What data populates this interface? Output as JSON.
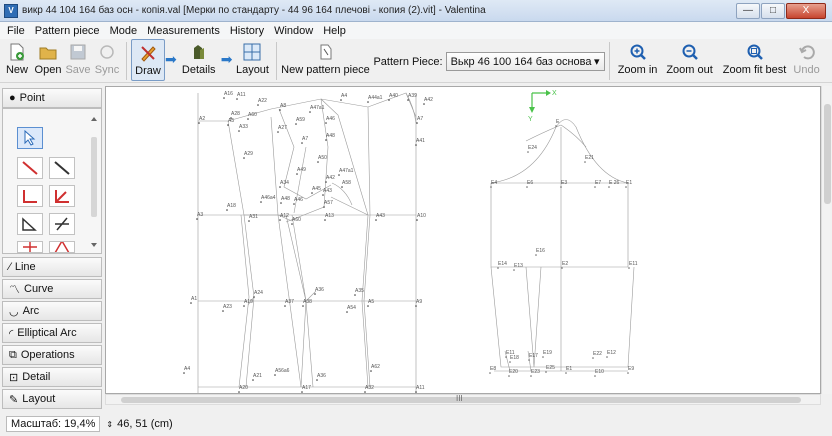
{
  "window": {
    "title": "викр 44 104 164 баз осн - копія.val [Мерки по стандарту - 44 96 164 плечові - копия (2).vit] - Valentina",
    "app_icon": "V",
    "minimize": "—",
    "maximize": "□",
    "close": "X"
  },
  "menu": [
    "File",
    "Pattern piece",
    "Mode",
    "Measurements",
    "History",
    "Window",
    "Help"
  ],
  "toolbar": {
    "new": "New",
    "open": "Open",
    "save": "Save",
    "sync": "Sync",
    "draw": "Draw",
    "details": "Details",
    "layout": "Layout",
    "new_pattern_piece": "New pattern piece",
    "pattern_piece_label": "Pattern Piece:",
    "pattern_piece_value": "Вькр 46 100 164 баз основа",
    "zoom_in": "Zoom in",
    "zoom_out": "Zoom out",
    "zoom_fit": "Zoom fit best",
    "undo": "Undo"
  },
  "left": {
    "point": "Point",
    "line": "Line",
    "curve": "Curve",
    "arc": "Arc",
    "elliptical_arc": "Elliptical Arc",
    "operations": "Operations",
    "detail": "Detail",
    "layout": "Layout"
  },
  "status": {
    "scale_label": "Масштаб: 19,4%",
    "coords": "46, 51 (cm)"
  },
  "canvas": {
    "axis_x": "X",
    "axis_y": "Y",
    "hscroll_marker": "III",
    "left_labels": [
      [
        "A16",
        118,
        8
      ],
      [
        "A11",
        131,
        9
      ],
      [
        "A22",
        152,
        15
      ],
      [
        "A8",
        174,
        20
      ],
      [
        "A47a1",
        204,
        22
      ],
      [
        "A4",
        235,
        10
      ],
      [
        "A44a1",
        262,
        12
      ],
      [
        "A40",
        283,
        10
      ],
      [
        "A39",
        302,
        10
      ],
      [
        "A42",
        318,
        14
      ],
      [
        "A2",
        93,
        33
      ],
      [
        "A28",
        125,
        28
      ],
      [
        "A5",
        122,
        35
      ],
      [
        "A60",
        142,
        29
      ],
      [
        "A33",
        133,
        41
      ],
      [
        "A27",
        172,
        42
      ],
      [
        "A59",
        190,
        34
      ],
      [
        "A46",
        220,
        33
      ],
      [
        "A7",
        311,
        33
      ],
      [
        "A7",
        196,
        53
      ],
      [
        "A48",
        220,
        50
      ],
      [
        "A41",
        310,
        55
      ],
      [
        "A29",
        138,
        68
      ],
      [
        "A50",
        212,
        72
      ],
      [
        "A49",
        191,
        84
      ],
      [
        "A47a1",
        233,
        85
      ],
      [
        "A42",
        220,
        92
      ],
      [
        "A58",
        236,
        97
      ],
      [
        "A34",
        174,
        97
      ],
      [
        "A45",
        206,
        103
      ],
      [
        "A43",
        217,
        105
      ],
      [
        "A46a4",
        155,
        112
      ],
      [
        "A48",
        175,
        113
      ],
      [
        "A46",
        188,
        114
      ],
      [
        "A57",
        218,
        117
      ],
      [
        "A3",
        91,
        129
      ],
      [
        "A18",
        121,
        120
      ],
      [
        "A31",
        143,
        131
      ],
      [
        "A12",
        174,
        130
      ],
      [
        "A60",
        186,
        134
      ],
      [
        "A13",
        219,
        130
      ],
      [
        "A43",
        270,
        130
      ],
      [
        "A10",
        311,
        130
      ],
      [
        "A24",
        148,
        207
      ],
      [
        "A36",
        209,
        204
      ],
      [
        "A35",
        249,
        205
      ],
      [
        "A1",
        85,
        213
      ],
      [
        "A23",
        117,
        221
      ],
      [
        "A19",
        138,
        216
      ],
      [
        "A37",
        179,
        216
      ],
      [
        "A38",
        197,
        216
      ],
      [
        "A54",
        241,
        222
      ],
      [
        "A5",
        262,
        216
      ],
      [
        "A9",
        310,
        216
      ],
      [
        "A4",
        78,
        283
      ],
      [
        "A21",
        147,
        290
      ],
      [
        "A56a6",
        169,
        285
      ],
      [
        "A36",
        211,
        290
      ],
      [
        "A62",
        265,
        281
      ],
      [
        "A20",
        133,
        302
      ],
      [
        "A17",
        196,
        302
      ],
      [
        "A32",
        259,
        302
      ],
      [
        "A11",
        310,
        302
      ]
    ],
    "right_labels": [
      [
        "E",
        450,
        36
      ],
      [
        "E24",
        422,
        62
      ],
      [
        "E21",
        479,
        72
      ],
      [
        "E4",
        385,
        97
      ],
      [
        "E6",
        421,
        97
      ],
      [
        "E3",
        455,
        97
      ],
      [
        "E7",
        489,
        97
      ],
      [
        "E 26",
        503,
        97
      ],
      [
        "E1",
        520,
        97
      ],
      [
        "E16",
        430,
        165
      ],
      [
        "E14",
        392,
        178
      ],
      [
        "E13",
        408,
        180
      ],
      [
        "E2",
        456,
        178
      ],
      [
        "E11",
        523,
        178
      ],
      [
        "E11",
        400,
        267
      ],
      [
        "E18",
        404,
        272
      ],
      [
        "E17",
        423,
        270
      ],
      [
        "E19",
        437,
        267
      ],
      [
        "E22",
        487,
        268
      ],
      [
        "E12",
        501,
        267
      ],
      [
        "E8",
        384,
        283
      ],
      [
        "E20",
        403,
        286
      ],
      [
        "E23",
        425,
        286
      ],
      [
        "E25",
        440,
        282
      ],
      [
        "E1",
        460,
        283
      ],
      [
        "E10",
        489,
        286
      ],
      [
        "E9",
        522,
        283
      ]
    ]
  }
}
